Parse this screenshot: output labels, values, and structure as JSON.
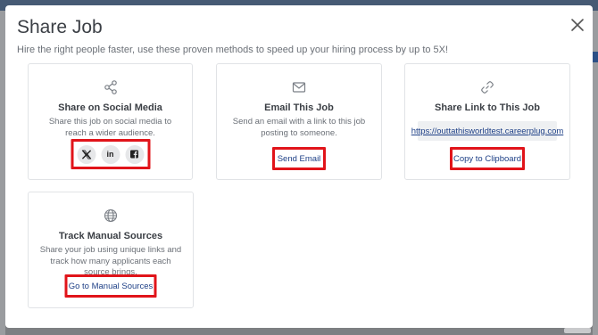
{
  "modal": {
    "title": "Share Job",
    "subtitle": "Hire the right people faster, use these proven methods to speed up your hiring process by up to 5X!"
  },
  "cards": {
    "social": {
      "title": "Share on Social Media",
      "description": "Share this job on social media to reach a wider audience.",
      "icon": "share-icon",
      "buttons": [
        "x-twitter-icon",
        "linkedin-icon",
        "facebook-icon"
      ]
    },
    "email": {
      "title": "Email This Job",
      "description": "Send an email with a link to this job posting to someone.",
      "icon": "envelope-icon",
      "button_label": "Send Email"
    },
    "link": {
      "title": "Share Link to This Job",
      "url": "https://outtathisworldtest.careerplug.com",
      "icon": "link-icon",
      "button_label": "Copy to Clipboard"
    },
    "manual": {
      "title": "Track Manual Sources",
      "description": "Share your job using unique links and track how many applicants each source brings.",
      "icon": "globe-icon",
      "button_label": "Go to Manual Sources"
    }
  },
  "colors": {
    "highlight": "#e1141a",
    "link": "#1d3f86",
    "text": "#3b3f45",
    "muted": "#6b7077"
  }
}
